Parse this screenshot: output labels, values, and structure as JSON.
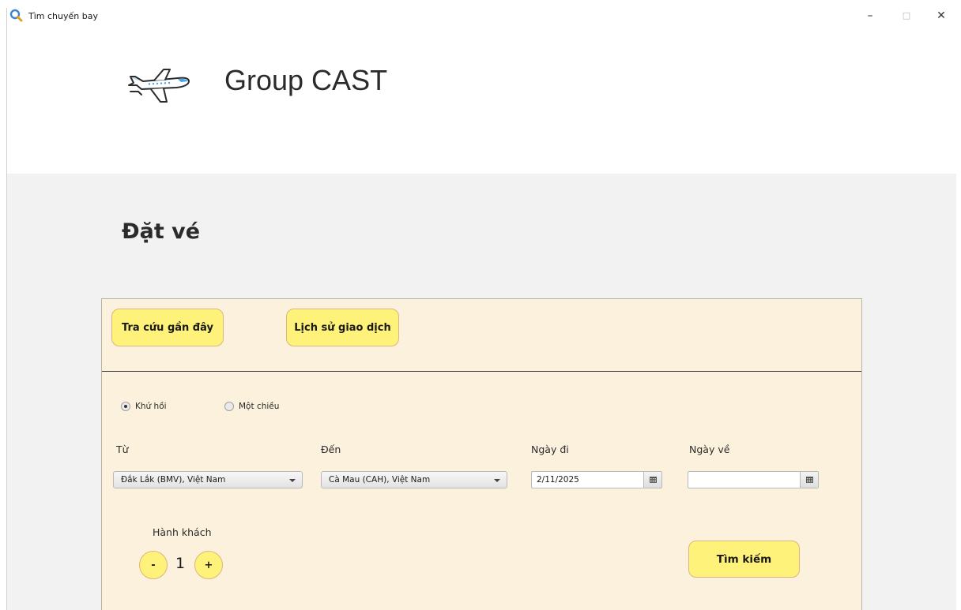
{
  "window": {
    "title": "Tìm chuyến bay",
    "minimize": "–",
    "maximize": "□",
    "close": "✕"
  },
  "header": {
    "brand": "Group CAST",
    "logo_icon": "airplane-icon"
  },
  "page": {
    "title": "Đặt vé"
  },
  "actions": {
    "recent_searches": "Tra cứu gần đây",
    "transaction_history": "Lịch sử giao dịch"
  },
  "trip_type": {
    "round_trip": "Khứ hồi",
    "one_way": "Một chiều",
    "selected": "round_trip"
  },
  "form": {
    "from_label": "Từ",
    "from_value": "Đắk Lắk (BMV), Việt Nam",
    "to_label": "Đến",
    "to_value": "Cà Mau (CAH), Việt Nam",
    "depart_label": "Ngày đi",
    "depart_value": "2/11/2025",
    "return_label": "Ngày về",
    "return_value": ""
  },
  "passengers": {
    "label": "Hành khách",
    "count": "1",
    "decrement": "-",
    "increment": "+"
  },
  "search": {
    "label": "Tìm kiếm"
  },
  "colors": {
    "button_yellow": "#fff27a",
    "card_background": "#fcf1dc",
    "page_background": "#f2f2f2"
  }
}
